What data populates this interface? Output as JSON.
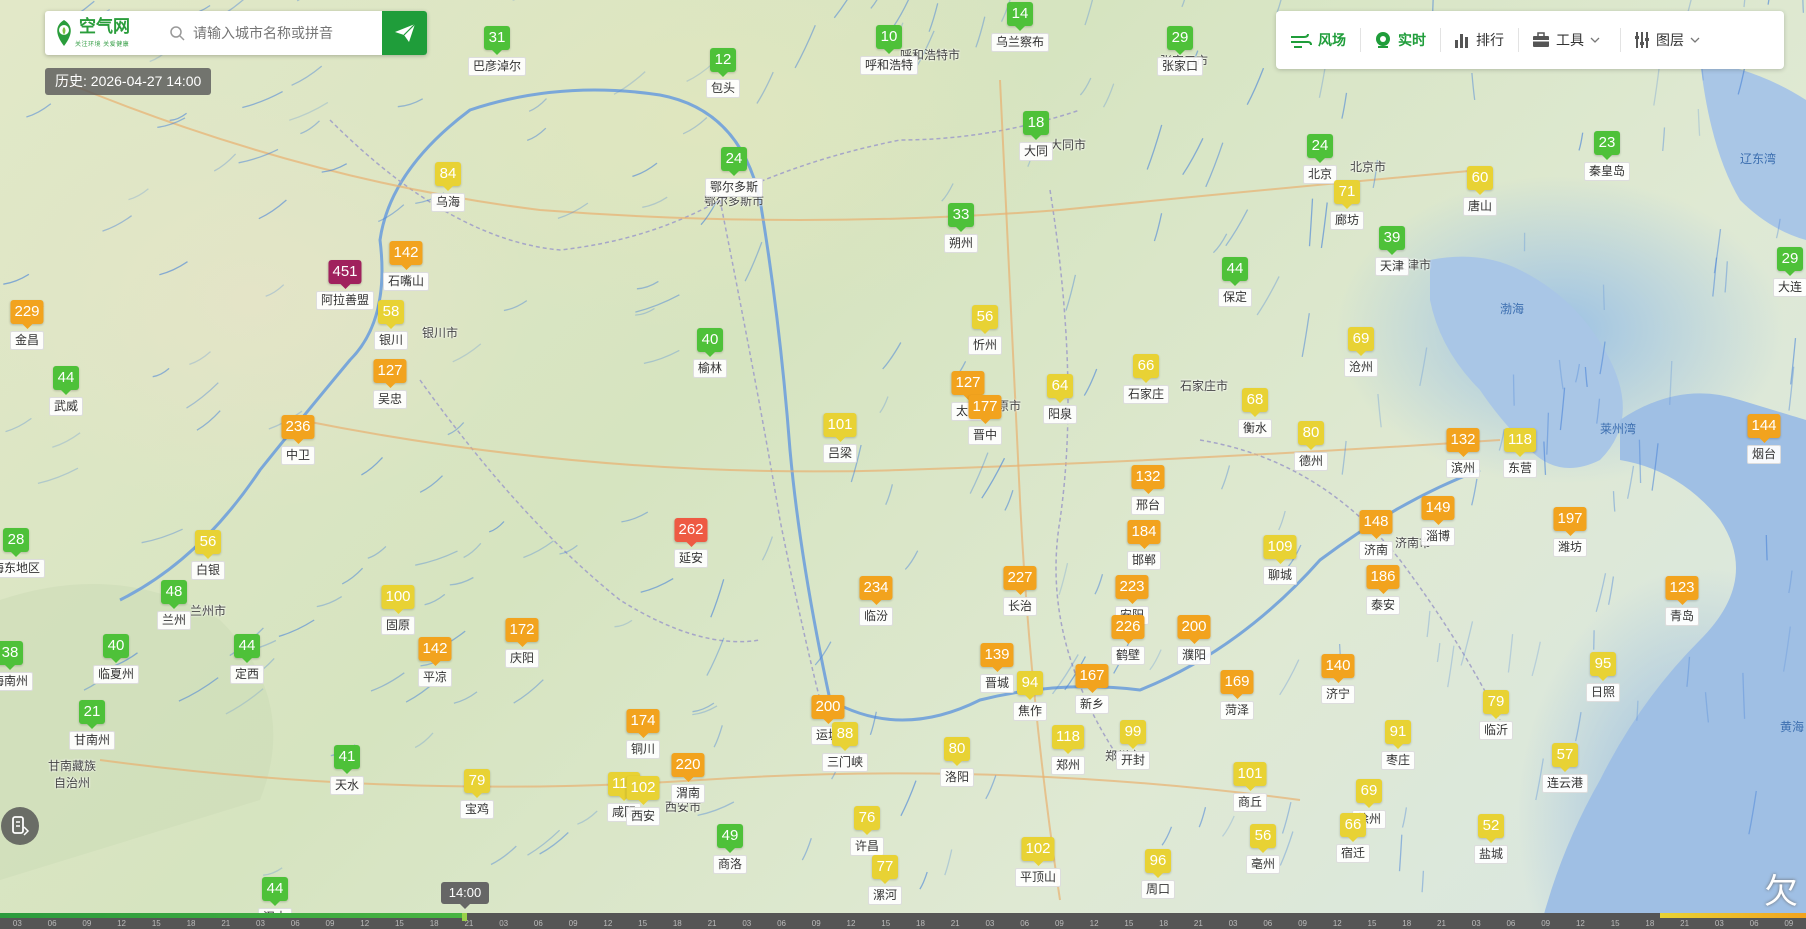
{
  "search": {
    "logo_text": "空气网",
    "logo_sub": "关注环境 关爱健康",
    "placeholder": "请输入城市名称或拼音"
  },
  "history_label": "历史: 2026-04-27 14:00",
  "toolbar": {
    "items": [
      {
        "label": "风场",
        "icon": "wind-icon",
        "active": true
      },
      {
        "label": "实时",
        "icon": "realtime-icon",
        "active": true
      },
      {
        "label": "排行",
        "icon": "ranking-icon",
        "active": false
      },
      {
        "label": "工具",
        "icon": "toolbox-icon",
        "active": false
      },
      {
        "label": "图层",
        "icon": "layers-icon",
        "active": false
      }
    ]
  },
  "colors": {
    "good": "#4ec139",
    "moderate": "#e8d234",
    "unhealthy_sensitive": "#f2a31e",
    "unhealthy": "#ee5a43",
    "hazardous": "#a0215d",
    "brand": "#1f9d3a"
  },
  "stations": [
    {
      "aqi": "31",
      "name": "巴彦淖尔",
      "level": "good"
    },
    {
      "aqi": "12",
      "name": "包头",
      "level": "good"
    },
    {
      "aqi": "10",
      "name": "呼和浩特",
      "level": "good"
    },
    {
      "aqi": "14",
      "name": "乌兰察布",
      "level": "good"
    },
    {
      "aqi": "29",
      "name": "张家口",
      "level": "good"
    },
    {
      "aqi": "84",
      "name": "乌海",
      "level": "mod"
    },
    {
      "aqi": "24",
      "name": "鄂尔多斯",
      "level": "good"
    },
    {
      "aqi": "18",
      "name": "大同",
      "level": "good"
    },
    {
      "aqi": "24",
      "name": "北京",
      "level": "good"
    },
    {
      "aqi": "23",
      "name": "秦皇岛",
      "level": "good"
    },
    {
      "aqi": "60",
      "name": "唐山",
      "level": "mod"
    },
    {
      "aqi": "71",
      "name": "廊坊",
      "level": "mod"
    },
    {
      "aqi": "142",
      "name": "石嘴山",
      "level": "usg"
    },
    {
      "aqi": "451",
      "name": "阿拉善盟",
      "level": "haz"
    },
    {
      "aqi": "33",
      "name": "朔州",
      "level": "good"
    },
    {
      "aqi": "39",
      "name": "天津",
      "level": "good"
    },
    {
      "aqi": "44",
      "name": "保定",
      "level": "good"
    },
    {
      "aqi": "229",
      "name": "金昌",
      "level": "usg"
    },
    {
      "aqi": "58",
      "name": "银川",
      "level": "mod"
    },
    {
      "aqi": "56",
      "name": "忻州",
      "level": "mod"
    },
    {
      "aqi": "40",
      "name": "榆林",
      "level": "good"
    },
    {
      "aqi": "69",
      "name": "沧州",
      "level": "mod"
    },
    {
      "aqi": "44",
      "name": "武威",
      "level": "good"
    },
    {
      "aqi": "127",
      "name": "吴忠",
      "level": "usg"
    },
    {
      "aqi": "66",
      "name": "石家庄",
      "level": "mod"
    },
    {
      "aqi": "127",
      "name": "太原",
      "level": "usg"
    },
    {
      "aqi": "64",
      "name": "阳泉",
      "level": "mod"
    },
    {
      "aqi": "177",
      "name": "晋中",
      "level": "usg"
    },
    {
      "aqi": "68",
      "name": "衡水",
      "level": "mod"
    },
    {
      "aqi": "236",
      "name": "中卫",
      "level": "usg"
    },
    {
      "aqi": "101",
      "name": "吕梁",
      "level": "mod"
    },
    {
      "aqi": "80",
      "name": "德州",
      "level": "mod"
    },
    {
      "aqi": "132",
      "name": "滨州",
      "level": "usg"
    },
    {
      "aqi": "118",
      "name": "东营",
      "level": "mod"
    },
    {
      "aqi": "144",
      "name": "烟台",
      "level": "usg"
    },
    {
      "aqi": "132",
      "name": "邢台",
      "level": "usg"
    },
    {
      "aqi": "28",
      "name": "海东地区",
      "level": "good"
    },
    {
      "aqi": "56",
      "name": "白银",
      "level": "mod"
    },
    {
      "aqi": "262",
      "name": "延安",
      "level": "unh"
    },
    {
      "aqi": "184",
      "name": "邯郸",
      "level": "usg"
    },
    {
      "aqi": "148",
      "name": "济南",
      "level": "usg"
    },
    {
      "aqi": "149",
      "name": "淄博",
      "level": "usg"
    },
    {
      "aqi": "197",
      "name": "潍坊",
      "level": "usg"
    },
    {
      "aqi": "109",
      "name": "聊城",
      "level": "mod"
    },
    {
      "aqi": "48",
      "name": "兰州",
      "level": "good"
    },
    {
      "aqi": "100",
      "name": "固原",
      "level": "mod"
    },
    {
      "aqi": "234",
      "name": "临汾",
      "level": "usg"
    },
    {
      "aqi": "227",
      "name": "长治",
      "level": "usg"
    },
    {
      "aqi": "223",
      "name": "安阳",
      "level": "usg"
    },
    {
      "aqi": "186",
      "name": "泰安",
      "level": "usg"
    },
    {
      "aqi": "123",
      "name": "青岛",
      "level": "usg"
    },
    {
      "aqi": "172",
      "name": "庆阳",
      "level": "usg"
    },
    {
      "aqi": "226",
      "name": "鹤壁",
      "level": "usg"
    },
    {
      "aqi": "200",
      "name": "濮阳",
      "level": "usg"
    },
    {
      "aqi": "38",
      "name": "海南州",
      "level": "good"
    },
    {
      "aqi": "40",
      "name": "临夏州",
      "level": "good"
    },
    {
      "aqi": "44",
      "name": "定西",
      "level": "good"
    },
    {
      "aqi": "142",
      "name": "平凉",
      "level": "usg"
    },
    {
      "aqi": "139",
      "name": "晋城",
      "level": "usg"
    },
    {
      "aqi": "94",
      "name": "焦作",
      "level": "mod"
    },
    {
      "aqi": "167",
      "name": "新乡",
      "level": "usg"
    },
    {
      "aqi": "169",
      "name": "菏泽",
      "level": "usg"
    },
    {
      "aqi": "140",
      "name": "济宁",
      "level": "usg"
    },
    {
      "aqi": "95",
      "name": "日照",
      "level": "mod"
    },
    {
      "aqi": "21",
      "name": "甘南州",
      "level": "good"
    },
    {
      "aqi": "174",
      "name": "铜川",
      "level": "usg"
    },
    {
      "aqi": "200",
      "name": "运城",
      "level": "usg"
    },
    {
      "aqi": "88",
      "name": "三门峡",
      "level": "mod"
    },
    {
      "aqi": "79",
      "name": "临沂",
      "level": "mod"
    },
    {
      "aqi": "41",
      "name": "天水",
      "level": "good"
    },
    {
      "aqi": "80",
      "name": "洛阳",
      "level": "mod"
    },
    {
      "aqi": "118",
      "name": "郑州",
      "level": "mod"
    },
    {
      "aqi": "99",
      "name": "开封",
      "level": "mod"
    },
    {
      "aqi": "91",
      "name": "枣庄",
      "level": "mod"
    },
    {
      "aqi": "57",
      "name": "连云港",
      "level": "mod"
    },
    {
      "aqi": "79",
      "name": "宝鸡",
      "level": "mod"
    },
    {
      "aqi": "115",
      "name": "咸阳",
      "level": "mod"
    },
    {
      "aqi": "102",
      "name": "西安",
      "level": "mod"
    },
    {
      "aqi": "220",
      "name": "渭南",
      "level": "usg"
    },
    {
      "aqi": "101",
      "name": "商丘",
      "level": "mod"
    },
    {
      "aqi": "69",
      "name": "徐州",
      "level": "mod"
    },
    {
      "aqi": "49",
      "name": "商洛",
      "level": "good"
    },
    {
      "aqi": "76",
      "name": "许昌",
      "level": "mod"
    },
    {
      "aqi": "102",
      "name": "平顶山",
      "level": "mod"
    },
    {
      "aqi": "56",
      "name": "亳州",
      "level": "mod"
    },
    {
      "aqi": "66",
      "name": "宿迁",
      "level": "mod"
    },
    {
      "aqi": "52",
      "name": "盐城",
      "level": "mod"
    },
    {
      "aqi": "77",
      "name": "漯河",
      "level": "mod"
    },
    {
      "aqi": "96",
      "name": "周口",
      "level": "mod"
    },
    {
      "aqi": "44",
      "name": "汉中",
      "level": "good"
    },
    {
      "aqi": "29",
      "name": "大连",
      "level": "good"
    }
  ],
  "map_labels": [
    "鄂尔多斯市",
    "呼和浩特市",
    "张家口市",
    "大同市",
    "北京市",
    "天津市",
    "石家庄市",
    "太原市",
    "济南市",
    "兰州市",
    "银川市",
    "西安市",
    "郑州市",
    "甘南藏族自治州",
    "渤海",
    "莱州湾",
    "辽东湾",
    "黄海"
  ],
  "timeline": {
    "current_time": "14:00",
    "tick_labels": [
      "03",
      "06",
      "09",
      "12",
      "15",
      "18",
      "21",
      "03",
      "06",
      "09",
      "12",
      "15",
      "18",
      "21",
      "03",
      "06",
      "09",
      "12",
      "15",
      "18",
      "21",
      "03",
      "06",
      "09",
      "12",
      "15",
      "18",
      "21",
      "03",
      "06",
      "09",
      "12",
      "15",
      "18",
      "21",
      "03",
      "06",
      "09",
      "12",
      "15",
      "18",
      "21",
      "03",
      "06",
      "09",
      "12",
      "15",
      "18",
      "21",
      "03",
      "06",
      "09"
    ]
  }
}
